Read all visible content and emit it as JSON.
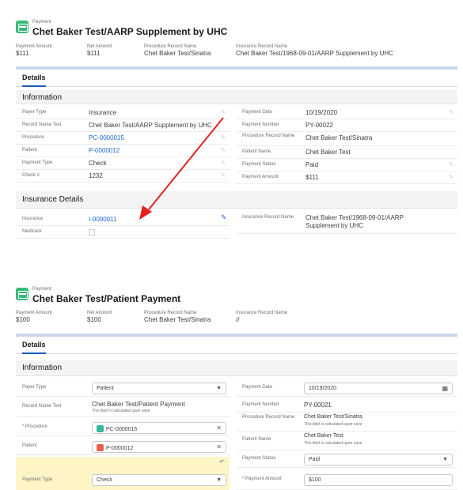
{
  "panel1": {
    "object_label": "Payment",
    "title": "Chet Baker Test/AARP Supplement by UHC",
    "header_fields": [
      {
        "label": "Payment Amount",
        "value": "$111"
      },
      {
        "label": "Net Amount",
        "value": "$111"
      },
      {
        "label": "Procedure Record Name",
        "value": "Chet Baker Test/Sinatra"
      },
      {
        "label": "Insurance Record Name",
        "value": "Chet Baker Test/1968-09-01/AARP Supplement by UHC"
      }
    ],
    "tab_details": "Details",
    "section_information": "Information",
    "left_rows": [
      {
        "label": "Payer Type",
        "value": "Insurance"
      },
      {
        "label": "Record Name Text",
        "value": "Chet Baker Test/AARP Supplement by UHC"
      },
      {
        "label": "Procedure",
        "value": "PC-0000015"
      },
      {
        "label": "Patient",
        "value": "P-0000012"
      },
      {
        "label": "Payment Type",
        "value": "Check"
      },
      {
        "label": "Check #",
        "value": "1232"
      }
    ],
    "right_rows": [
      {
        "label": "Payment Date",
        "value": "10/19/2020"
      },
      {
        "label": "Payment Number",
        "value": "PY-00022"
      },
      {
        "label": "Procedure Record Name",
        "value": "Chet Baker Test/Sinatra"
      },
      {
        "label": "Patient Name",
        "value": "Chet Baker Test"
      },
      {
        "label": "Payment Status",
        "value": "Paid"
      },
      {
        "label": "Payment Amount",
        "value": "$111"
      }
    ],
    "section_insurance": "Insurance Details",
    "insurance_rows": [
      {
        "label": "Insurance",
        "value": "I-0000011"
      },
      {
        "label": "Medicare",
        "value": ""
      }
    ],
    "insurance_record_label": "Insurance Record Name",
    "insurance_record_value_1": "Chet Baker Test/1968-09-01/AARP",
    "insurance_record_value_2": "Supplement by UHC"
  },
  "panel2": {
    "object_label": "Payment",
    "title": "Chet Baker Test/Patient Payment",
    "header_fields": [
      {
        "label": "Payment Amount",
        "value": "$100"
      },
      {
        "label": "Net Amount",
        "value": "$100"
      },
      {
        "label": "Procedure Record Name",
        "value": "Chet Baker Test/Sinatra"
      },
      {
        "label": "Insurance Record Name",
        "value": "//"
      }
    ],
    "tab_details": "Details",
    "section_information": "Information",
    "payer_type_label": "Payer Type",
    "payer_type_value": "Patient",
    "record_name_label": "Record Name Text",
    "record_name_value": "Chet Baker Test/Patient Payment",
    "calc_note": "This field is calculated upon save",
    "procedure_label": "* Procedure",
    "procedure_value": "PC-0000015",
    "patient_label": "Patient",
    "patient_value": "P-0000012",
    "payment_type_label": "Payment Type",
    "payment_type_value": "Check",
    "payment_date_label": "Payment Date",
    "payment_date_value": "10/19/2020",
    "payment_number_label": "Payment Number",
    "payment_number_value": "PY-00021",
    "proc_record_label": "Procedure Record Name",
    "proc_record_value": "Chet Baker Test/Sinatra",
    "patient_name_label": "Patient Name",
    "patient_name_value": "Chet Baker Test",
    "payment_status_label": "Payment Status",
    "payment_status_value": "Paid",
    "payment_amount_label": "* Payment Amount",
    "payment_amount_value": "$100"
  },
  "colors": {
    "accent_green": "#3aba7a",
    "link_blue": "#1b6ad4",
    "arrow_red": "#e32020",
    "highlight_yellow": "#fdf5c6"
  }
}
